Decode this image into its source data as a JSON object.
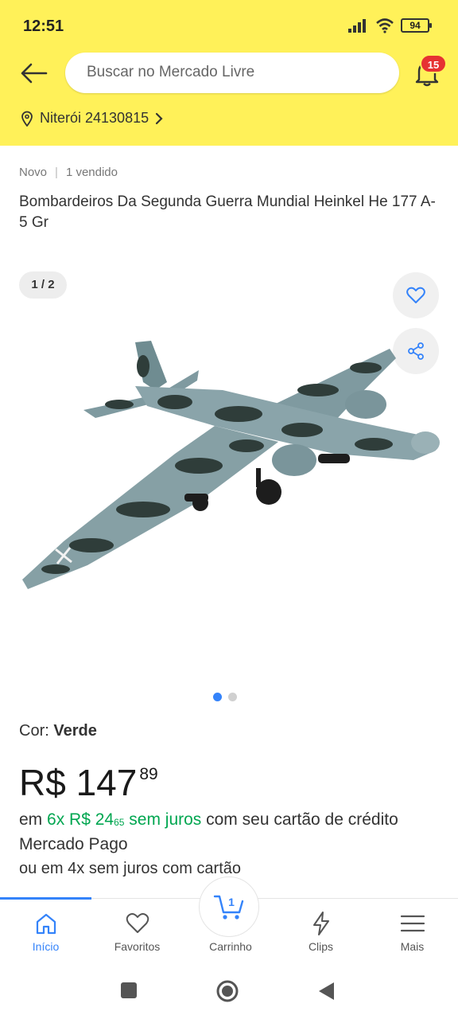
{
  "status_bar": {
    "time": "12:51",
    "battery": "94"
  },
  "header": {
    "search_placeholder": "Buscar no Mercado Livre",
    "notification_count": "15",
    "location": "Niterói 24130815",
    "accent_color": "#fff159"
  },
  "product": {
    "condition": "Novo",
    "sold": "1 vendido",
    "title": "Bombardeiros Da Segunda Guerra Mundial Heinkel He 177 A-5 Gr",
    "image_counter": "1 / 2",
    "color_label": "Cor: ",
    "color_value": "Verde",
    "price_main": "R$ 147",
    "price_cents": "89",
    "installment": {
      "prefix": "em ",
      "count_price": "6x R$ 24",
      "cents": "65",
      "no_interest": " sem juros",
      "suffix": " com seu cartão de crédito Mercado Pago"
    },
    "installment_alt": "ou em 4x sem juros com cartão"
  },
  "bottom_nav": {
    "items": [
      {
        "label": "Início",
        "icon": "home-icon"
      },
      {
        "label": "Favoritos",
        "icon": "heart-icon"
      },
      {
        "label": "Carrinho",
        "icon": "cart-icon"
      },
      {
        "label": "Clips",
        "icon": "lightning-icon"
      },
      {
        "label": "Mais",
        "icon": "menu-icon"
      }
    ],
    "cart_count": "1",
    "active_color": "#3483fa"
  }
}
